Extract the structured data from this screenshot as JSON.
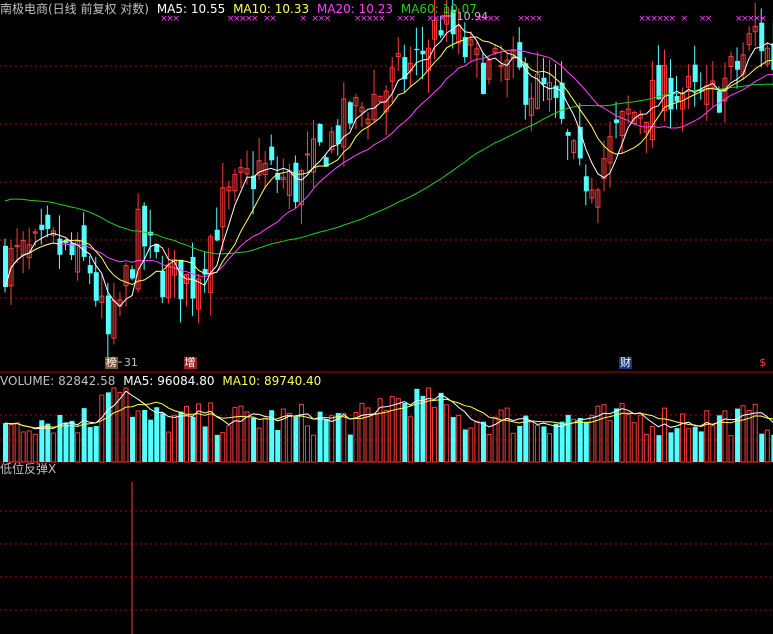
{
  "colors": {
    "bg": "#000000",
    "up": "#ff3b3b",
    "down": "#54ffff",
    "ma5": "#ffffff",
    "ma10": "#ffff55",
    "ma20": "#ff40ff",
    "ma60": "#22cc22",
    "grid": "#b40000",
    "text": "#c0c0c0",
    "marker": "#ff40ff"
  },
  "price_panel": {
    "stock": "南极电商(日线 前复权 对数)",
    "ma5": "MA5: 10.55",
    "ma10": "MA10: 10.33",
    "ma20": "MA20: 10.23",
    "ma60": "MA60: 10.07",
    "high_label": "10.94",
    "low_label": "31",
    "x_markers": "×",
    "tags": [
      {
        "id": "bang",
        "text": "榜",
        "color": "#ffffff",
        "bg": "#7a5a2a",
        "bar": 17
      },
      {
        "id": "zeng",
        "text": "增",
        "color": "#ffffff",
        "bg": "#a02020",
        "bar": 30
      },
      {
        "id": "cai",
        "text": "财",
        "color": "#ffffff",
        "bg": "#1a3a7a",
        "bar": 102
      },
      {
        "id": "dollar",
        "text": "$",
        "color": "#ff3b3b",
        "bg": "#000000",
        "bar": 125
      }
    ]
  },
  "volume_panel": {
    "volume": "VOLUME: 82842.58",
    "ma5": "MA5: 96084.80",
    "ma10": "MA10: 89740.40"
  },
  "indicator_panel": {
    "title": "低位反弹X"
  },
  "chart_data": {
    "type": "candlestick",
    "scale": "log",
    "bars": 128,
    "price_min": 8.31,
    "price_max": 10.94,
    "ma_last": {
      "ma5": 10.55,
      "ma10": 10.33,
      "ma20": 10.23,
      "ma60": 10.07
    },
    "volume_last": 82842.58,
    "volume_ma5_last": 96084.8,
    "volume_ma10_last": 89740.4,
    "signal_bar": 21
  }
}
